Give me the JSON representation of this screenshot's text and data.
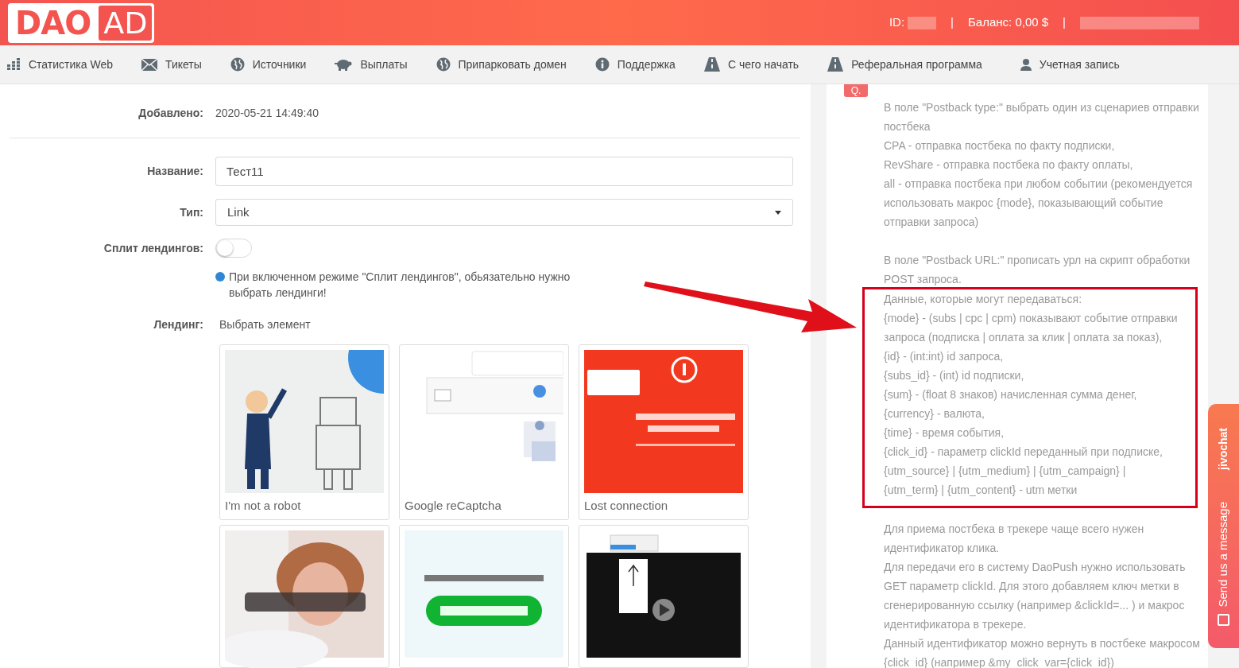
{
  "header": {
    "logo_left": "DAO",
    "logo_right": "AD",
    "id_label": "ID:",
    "separator": "|",
    "balance": "Баланс: 0,00 $",
    "separator_2": "|"
  },
  "nav": [
    {
      "label": "Статистика Web"
    },
    {
      "label": "Тикеты"
    },
    {
      "label": "Источники"
    },
    {
      "label": "Выплаты"
    },
    {
      "label": "Припарковать домен"
    },
    {
      "label": "Поддержка"
    },
    {
      "label": "С чего начать"
    },
    {
      "label": "Реферальная программа"
    },
    {
      "label": "Учетная запись"
    }
  ],
  "form": {
    "added_label": "Добавлено:",
    "added_value": "2020-05-21 14:49:40",
    "name_label": "Название:",
    "name_value": "Тест11",
    "type_label": "Тип:",
    "type_value": "Link",
    "split_label": "Сплит лендингов:",
    "split_on": false,
    "split_note": "При включенном режиме \"Сплит лендингов\", обьязательно нужно выбрать лендинги!",
    "landing_label": "Лендинг:",
    "landing_placeholder": "Выбрать элемент",
    "landings": [
      {
        "caption": "I'm not a robot",
        "kind": "picture"
      },
      {
        "caption": "Google reCaptcha",
        "kind": "picture"
      },
      {
        "caption": "Lost connection",
        "kind": "picture"
      },
      {
        "kind": "picture"
      },
      {
        "kind": "picture"
      },
      {
        "kind": "picture"
      }
    ]
  },
  "help": {
    "badge": "Q.",
    "blocks": [
      {
        "boxed": false,
        "lines": [
          "В поле \"Postback type:\" выбрать один из сценариев отправки",
          "постбека",
          "CPA - отправка постбека по факту подписки,",
          "RevShare - отправка постбека по факту оплаты,",
          "all - отправка постбека при любом событии (рекомендуется",
          "использовать макрос {mode}, показывающий событие",
          "отправки запроса)"
        ]
      },
      {
        "boxed": false,
        "lines": [
          "В поле \"Postback URL:\" прописать урл на скрипт обработки",
          "POST запроса."
        ]
      },
      {
        "boxed": true,
        "lines": [
          "Данные, которые могут передаваться:",
          "{mode} - (subs | cpc | cpm) показывают событие отправки",
          "запроса (подписка | оплата за клик | оплата за показ),",
          "{id} - (int:int) id запроса,",
          "{subs_id} - (int) id подписки,",
          "{sum} - (float 8 знаков) начисленная сумма денег,",
          "{currency} - валюта,",
          "{time} - время события,",
          "{click_id} - параметр clickId переданный при подписке,",
          "{utm_source} | {utm_medium} | {utm_campaign} |",
          "{utm_term} | {utm_content} - utm метки"
        ]
      },
      {
        "boxed": false,
        "lines": [
          "Для приема постбека в трекере чаще всего нужен",
          "идентификатор клика.",
          "Для передачи его в систему DaoPush нужно использовать",
          "GET параметр clickId. Для этого добавляем ключ метки в",
          "сгенерированную ссылку (например &clickId=... ) и макрос",
          "идентификатора в трекере.",
          "Данный идентификатор можно вернуть в постбеке макросом",
          "{click_id} (например &my_click_var={click_id})"
        ]
      }
    ]
  },
  "chat": {
    "brand": "jivochat",
    "label": "Send us a message"
  }
}
